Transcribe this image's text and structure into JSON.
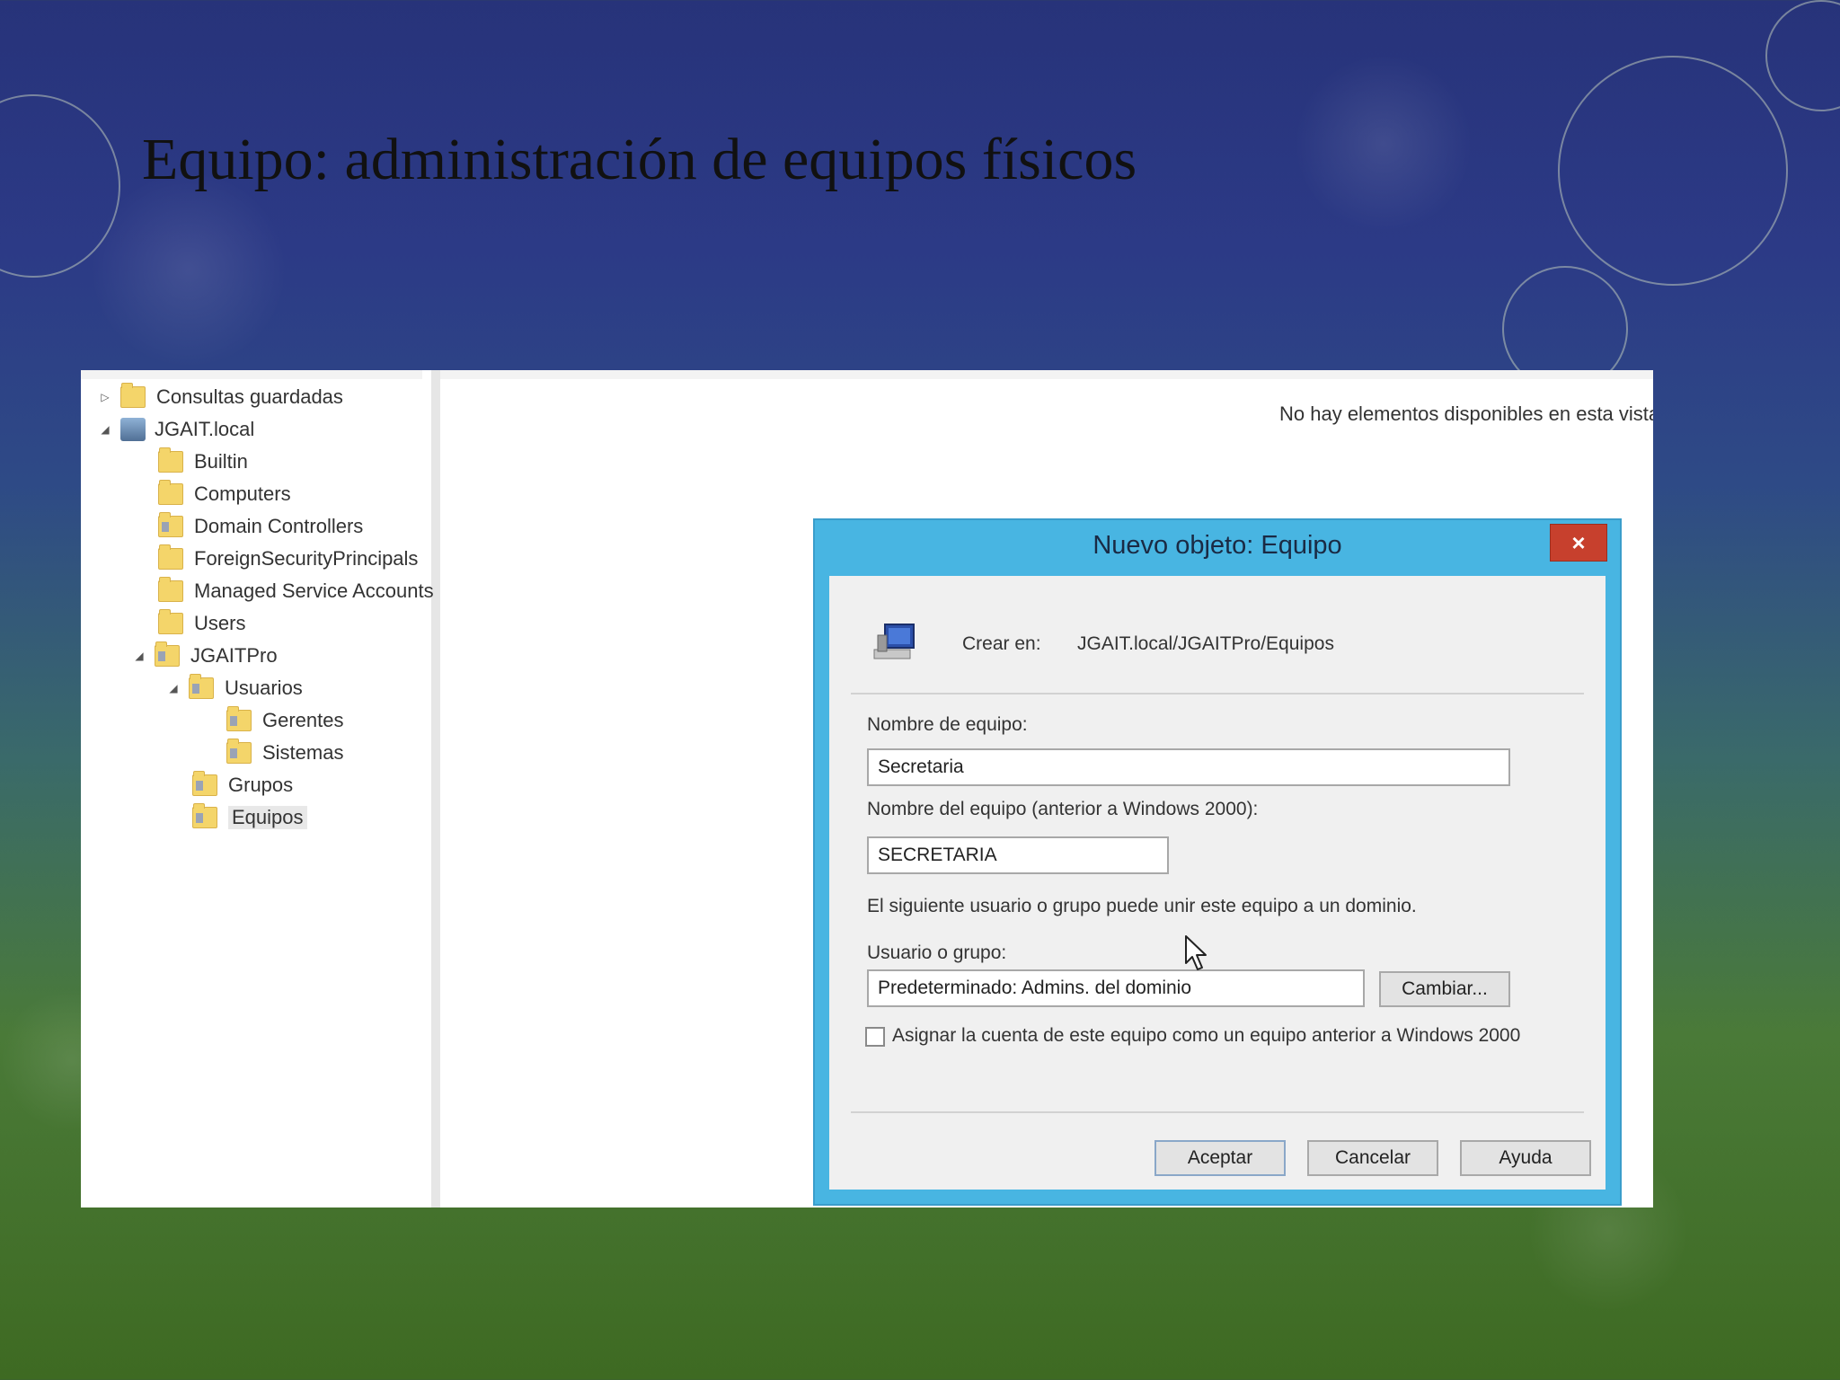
{
  "slide": {
    "title": "Equipo: administración de equipos físicos"
  },
  "tree": {
    "items": [
      {
        "label": "Consultas guardadas"
      },
      {
        "label": "JGAIT.local"
      },
      {
        "label": "Builtin"
      },
      {
        "label": "Computers"
      },
      {
        "label": "Domain Controllers"
      },
      {
        "label": "ForeignSecurityPrincipals"
      },
      {
        "label": "Managed Service Accounts"
      },
      {
        "label": "Users"
      },
      {
        "label": "JGAITPro"
      },
      {
        "label": "Usuarios"
      },
      {
        "label": "Gerentes"
      },
      {
        "label": "Sistemas"
      },
      {
        "label": "Grupos"
      },
      {
        "label": "Equipos"
      }
    ]
  },
  "list": {
    "empty_message": "No hay elementos disponibles en esta vista."
  },
  "dialog": {
    "title": "Nuevo objeto: Equipo",
    "close_label": "×",
    "crear_en_label": "Crear en:",
    "crear_en_path": "JGAIT.local/JGAITPro/Equipos",
    "nombre_equipo_label": "Nombre de equipo:",
    "nombre_equipo_value": "Secretaria",
    "nombre_pre2000_label": "Nombre del equipo (anterior a Windows 2000):",
    "nombre_pre2000_value": "SECRETARIA",
    "info_text": "El siguiente usuario o grupo puede unir este equipo a un dominio.",
    "usuario_grupo_label": "Usuario o grupo:",
    "usuario_grupo_value": "Predeterminado: Admins. del dominio",
    "cambiar_label": "Cambiar...",
    "checkbox_label": "Asignar la cuenta de este equipo como un equipo anterior a Windows 2000",
    "aceptar_label": "Aceptar",
    "cancelar_label": "Cancelar",
    "ayuda_label": "Ayuda"
  }
}
